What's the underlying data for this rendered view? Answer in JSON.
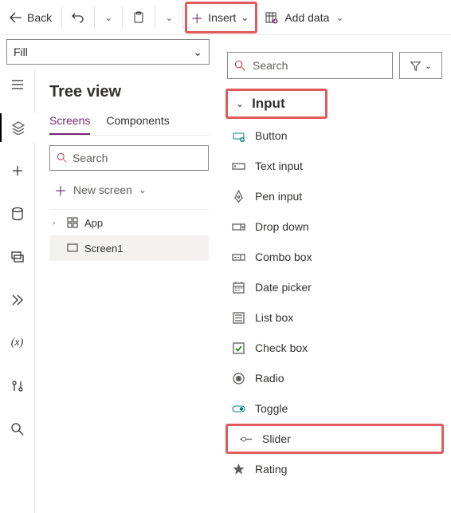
{
  "toolbar": {
    "back": "Back",
    "insert": "Insert",
    "add_data": "Add data"
  },
  "fill": {
    "label": "Fill"
  },
  "tree": {
    "title": "Tree view",
    "tabs": {
      "screens": "Screens",
      "components": "Components"
    },
    "search_placeholder": "Search",
    "new_screen": "New screen",
    "app": "App",
    "screen1": "Screen1"
  },
  "insert_panel": {
    "search_placeholder": "Search",
    "category": "Input",
    "items": {
      "button": "Button",
      "text_input": "Text input",
      "pen_input": "Pen input",
      "drop_down": "Drop down",
      "combo_box": "Combo box",
      "date_picker": "Date picker",
      "list_box": "List box",
      "check_box": "Check box",
      "radio": "Radio",
      "toggle": "Toggle",
      "slider": "Slider",
      "rating": "Rating"
    }
  }
}
